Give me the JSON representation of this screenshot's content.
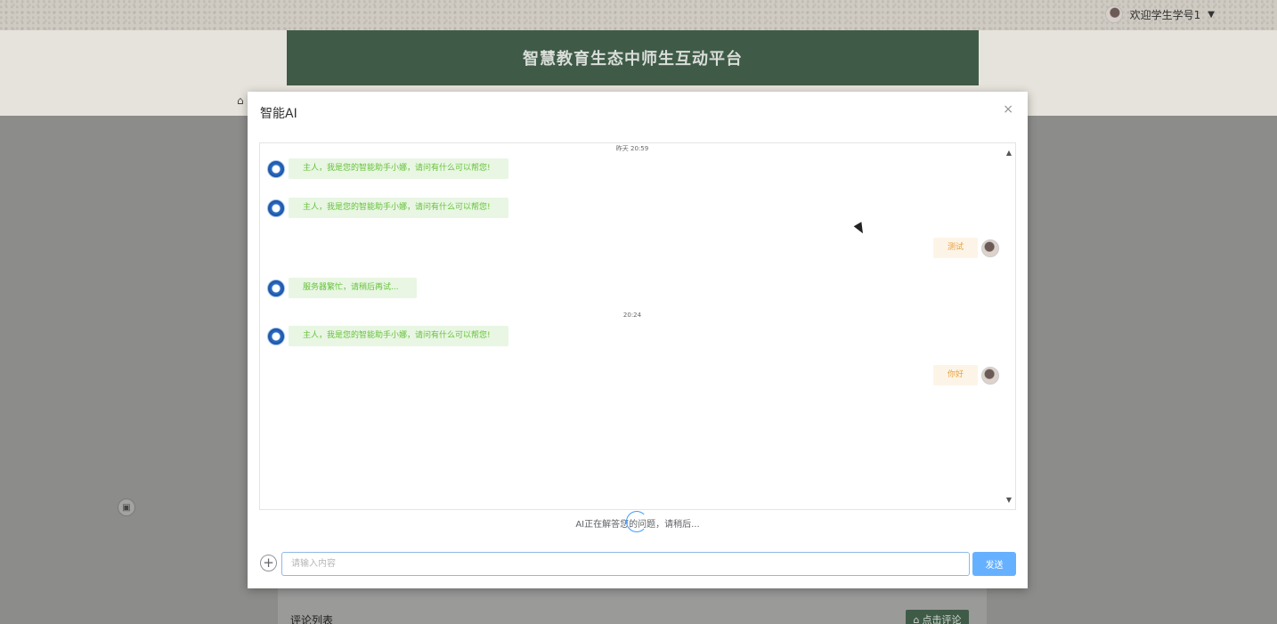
{
  "header": {
    "welcome_text": "欢迎学生学号1",
    "caret": "▼",
    "site_title": "智慧教育生态中师生互动平台"
  },
  "background": {
    "comment_list_title": "评论列表",
    "comment_button_label": "点击评论"
  },
  "modal": {
    "title": "智能AI",
    "close": "×",
    "messages": [
      {
        "type": "timestamp",
        "text": "昨天 20:59"
      },
      {
        "type": "bot",
        "text": "主人，我是您的智能助手小娜，请问有什么可以帮您!"
      },
      {
        "type": "bot",
        "text": "主人，我是您的智能助手小娜，请问有什么可以帮您!"
      },
      {
        "type": "user",
        "text": "测试"
      },
      {
        "type": "bot",
        "text": "服务器繁忙，请稍后再试..."
      },
      {
        "type": "timestamp",
        "text": "20:24"
      },
      {
        "type": "bot",
        "text": "主人，我是您的智能助手小娜，请问有什么可以帮您!"
      },
      {
        "type": "user",
        "text": "你好"
      }
    ],
    "status_text": "AI正在解答您的问题，请稍后...",
    "input_placeholder": "请输入内容",
    "input_value": "",
    "send_label": "发送",
    "plus": "+"
  },
  "icons": {
    "scroll_up": "▲",
    "scroll_down": "▼",
    "home": "⌂"
  }
}
